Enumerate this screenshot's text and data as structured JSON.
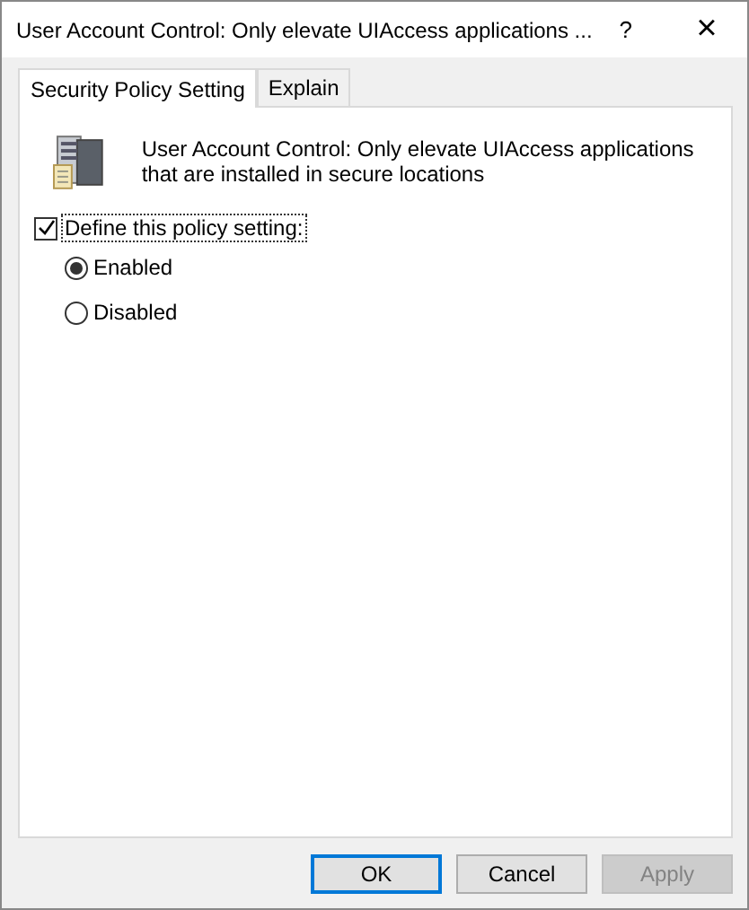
{
  "window": {
    "title": "User Account Control: Only elevate UIAccess applications ...",
    "help": "?",
    "close": "×"
  },
  "tabs": [
    {
      "label": "Security Policy Setting",
      "selected": true
    },
    {
      "label": "Explain",
      "selected": false
    }
  ],
  "policy": {
    "description": "User Account Control: Only elevate UIAccess applications that are installed in secure locations"
  },
  "define_setting": {
    "label": "Define this policy setting:",
    "checked": true
  },
  "options": [
    {
      "label": "Enabled",
      "selected": true
    },
    {
      "label": "Disabled",
      "selected": false
    }
  ],
  "buttons": [
    {
      "label": "OK",
      "default": true,
      "disabled": false
    },
    {
      "label": "Cancel",
      "default": false,
      "disabled": false
    },
    {
      "label": "Apply",
      "default": false,
      "disabled": true
    }
  ]
}
